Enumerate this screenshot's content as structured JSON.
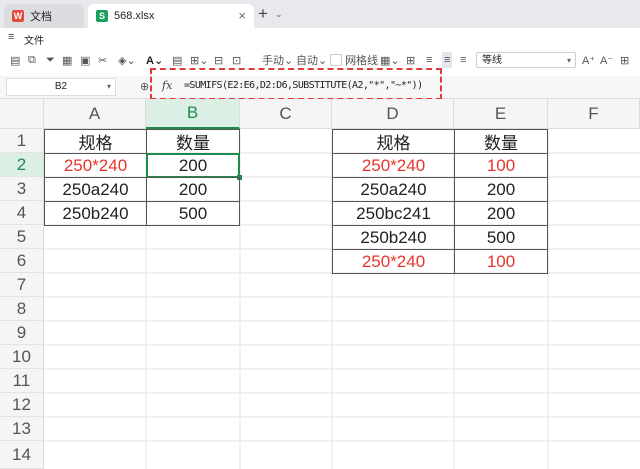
{
  "tabs": {
    "home_label": "文档",
    "file_label": "568.xlsx"
  },
  "menu": {
    "file_label": "文件"
  },
  "toolbar": {
    "manual_label": "手动",
    "auto_label": "自动",
    "gridlines_label": "网格线",
    "font_name": "等线"
  },
  "formula_bar": {
    "cell_ref": "B2",
    "fx_label": "fx",
    "formula": "=SUMIFS(E2:E6,D2:D6,SUBSTITUTE(A2,\"*\",\"~*\"))"
  },
  "columns": [
    "A",
    "B",
    "C",
    "D",
    "E",
    "F"
  ],
  "rows": [
    "1",
    "2",
    "3",
    "4",
    "5",
    "6",
    "7",
    "8",
    "9",
    "10",
    "11",
    "12",
    "13",
    "14"
  ],
  "left_table": {
    "headers": [
      "规格",
      "数量"
    ],
    "rows": [
      [
        "250*240",
        "200"
      ],
      [
        "250a240",
        "200"
      ],
      [
        "250b240",
        "500"
      ]
    ]
  },
  "right_table": {
    "headers": [
      "规格",
      "数量"
    ],
    "rows": [
      [
        "250*240",
        "100"
      ],
      [
        "250a240",
        "200"
      ],
      [
        "250bc241",
        "200"
      ],
      [
        "250b240",
        "500"
      ],
      [
        "250*240",
        "100"
      ]
    ]
  },
  "colors": {
    "accent": "#1e8c4e",
    "highlight_red": "#e8342e",
    "annotation": "#e23a3a"
  }
}
